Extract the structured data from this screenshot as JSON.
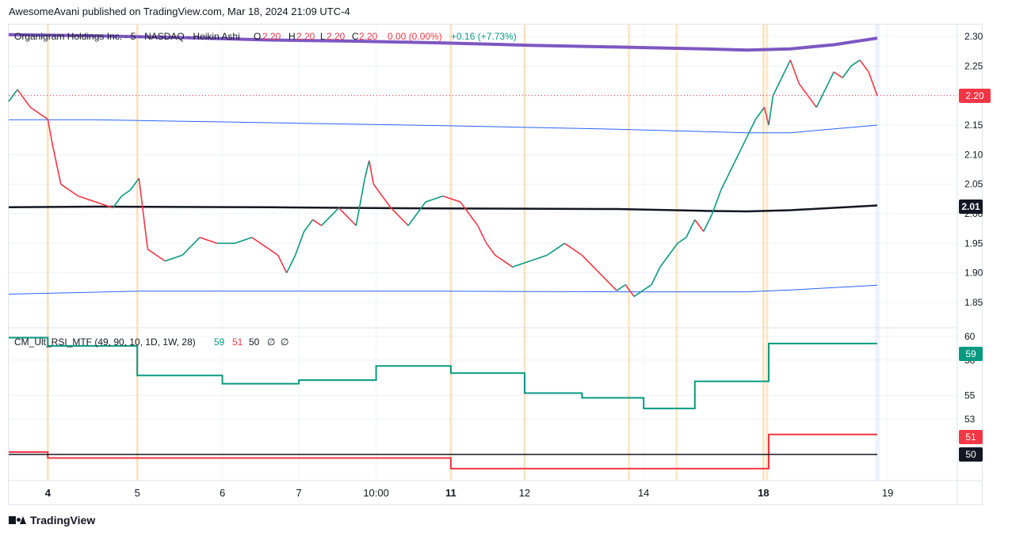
{
  "header": {
    "publish_line": "AwesomeAvani published on TradingView.com, Mar 18, 2024 21:09 UTC-4"
  },
  "footer": {
    "brand": "TradingView"
  },
  "colors": {
    "up": "#089981",
    "down": "#f23645",
    "ma_purple": "#7e57c2",
    "band_blue": "#2962ff",
    "mid_black": "#131722",
    "rsi_green": "#089981",
    "rsi_red": "#f23645",
    "grid": "#f0f3fa",
    "session_orange": "#ff9800",
    "axis_text": "#131722"
  },
  "main_pane": {
    "symbol": "Organigram Holdings Inc. · 5 · NASDAQ · Heikin Ashi",
    "ohlc": {
      "o_label": "O",
      "o": "2.20",
      "h_label": "H",
      "h": "2.20",
      "l_label": "L",
      "l": "2.20",
      "c_label": "C",
      "c": "2.20",
      "change": "0.00 (0.00%)",
      "extra": "+0.16 (+7.73%)"
    },
    "last_price_label": "2.20",
    "mid_line_label": "2.01"
  },
  "rsi_pane": {
    "title": "CM_Ult_RSI_MTF (49, 90, 10, 1D, 1W, 28)",
    "values": [
      "59",
      "51",
      "50",
      "∅",
      "∅"
    ],
    "labels": {
      "green": "59",
      "red": "51",
      "black": "50"
    }
  },
  "chart_data": [
    {
      "type": "line",
      "title": "Organigram Holdings Inc. · 5 · NASDAQ · Heikin Ashi",
      "y_ticks": [
        "2.30",
        "2.25",
        "2.20",
        "2.15",
        "2.10",
        "2.05",
        "2.00",
        "1.95",
        "1.90",
        "1.85"
      ],
      "ylim": [
        1.82,
        2.31
      ],
      "x_ticks": [
        {
          "label": "4",
          "bold": true,
          "t": 0.045
        },
        {
          "label": "5",
          "bold": false,
          "t": 0.148
        },
        {
          "label": "6",
          "bold": false,
          "t": 0.246
        },
        {
          "label": "7",
          "bold": false,
          "t": 0.334
        },
        {
          "label": "10:00",
          "bold": false,
          "t": 0.423
        },
        {
          "label": "11",
          "bold": true,
          "t": 0.509
        },
        {
          "label": "12",
          "bold": false,
          "t": 0.594
        },
        {
          "label": "14",
          "bold": false,
          "t": 0.731
        },
        {
          "label": "18",
          "bold": true,
          "t": 0.869
        },
        {
          "label": "19",
          "bold": false,
          "t": 1.012
        }
      ],
      "series": [
        {
          "role": "price",
          "color": "#089981",
          "x": [
            0,
            0.01,
            0.025,
            0.045,
            0.05,
            0.06,
            0.08,
            0.1,
            0.12,
            0.13,
            0.14,
            0.15,
            0.155,
            0.16,
            0.18,
            0.2,
            0.22,
            0.24,
            0.26,
            0.28,
            0.3,
            0.31,
            0.32,
            0.33,
            0.34,
            0.35,
            0.36,
            0.38,
            0.4,
            0.41,
            0.415,
            0.42,
            0.43,
            0.44,
            0.46,
            0.47,
            0.48,
            0.5,
            0.52,
            0.53,
            0.54,
            0.55,
            0.56,
            0.58,
            0.6,
            0.62,
            0.63,
            0.64,
            0.66,
            0.68,
            0.7,
            0.71,
            0.72,
            0.73,
            0.74,
            0.75,
            0.76,
            0.77,
            0.78,
            0.79,
            0.8,
            0.81,
            0.82,
            0.83,
            0.84,
            0.85,
            0.86,
            0.87,
            0.875,
            0.88,
            0.89,
            0.9,
            0.91,
            0.92,
            0.93,
            0.94,
            0.95,
            0.96,
            0.97,
            0.98,
            0.99,
            1.0
          ],
          "y": [
            2.19,
            2.21,
            2.18,
            2.16,
            2.12,
            2.05,
            2.03,
            2.02,
            2.01,
            2.03,
            2.04,
            2.06,
            2.0,
            1.94,
            1.92,
            1.93,
            1.96,
            1.95,
            1.95,
            1.96,
            1.94,
            1.93,
            1.9,
            1.93,
            1.97,
            1.99,
            1.98,
            2.01,
            1.98,
            2.06,
            2.09,
            2.05,
            2.03,
            2.01,
            1.98,
            2.0,
            2.02,
            2.03,
            2.02,
            2.0,
            1.98,
            1.95,
            1.93,
            1.91,
            1.92,
            1.93,
            1.94,
            1.95,
            1.93,
            1.9,
            1.87,
            1.88,
            1.86,
            1.87,
            1.88,
            1.91,
            1.93,
            1.95,
            1.96,
            1.99,
            1.97,
            2.0,
            2.04,
            2.07,
            2.1,
            2.13,
            2.16,
            2.18,
            2.15,
            2.2,
            2.23,
            2.26,
            2.22,
            2.2,
            2.18,
            2.21,
            2.24,
            2.23,
            2.25,
            2.26,
            2.24,
            2.2
          ]
        },
        {
          "role": "ma_long",
          "name": "",
          "color": "#7e57c2",
          "x": [
            0,
            0.1,
            0.2,
            0.3,
            0.4,
            0.5,
            0.6,
            0.7,
            0.8,
            0.85,
            0.9,
            0.95,
            1.0
          ],
          "y": [
            2.303,
            2.301,
            2.298,
            2.294,
            2.292,
            2.289,
            2.285,
            2.282,
            2.279,
            2.277,
            2.279,
            2.286,
            2.297
          ]
        },
        {
          "role": "band_upper",
          "color": "#2962ff",
          "x": [
            0,
            0.1,
            0.3,
            0.5,
            0.7,
            0.85,
            0.9,
            1.0
          ],
          "y": [
            2.159,
            2.159,
            2.154,
            2.149,
            2.143,
            2.137,
            2.137,
            2.15
          ]
        },
        {
          "role": "mid",
          "color": "#131722",
          "x": [
            0,
            0.1,
            0.3,
            0.5,
            0.7,
            0.8,
            0.85,
            0.9,
            1.0
          ],
          "y": [
            2.011,
            2.012,
            2.011,
            2.009,
            2.008,
            2.005,
            2.004,
            2.006,
            2.014
          ]
        },
        {
          "role": "band_lower",
          "color": "#2962ff",
          "x": [
            0,
            0.15,
            0.3,
            0.5,
            0.7,
            0.85,
            0.9,
            1.0
          ],
          "y": [
            1.864,
            1.869,
            1.869,
            1.869,
            1.868,
            1.868,
            1.871,
            1.879
          ]
        }
      ],
      "last_price": 2.2,
      "session_lines": [
        0.045,
        0.148,
        0.509,
        0.594,
        0.714,
        0.769,
        0.869,
        0.873
      ]
    },
    {
      "type": "line",
      "title": "CM_Ult_RSI_MTF (49, 90, 10, 1D, 1W, 28)",
      "y_ticks": [
        "60",
        "58",
        "55",
        "53"
      ],
      "ylim": [
        48,
        61
      ],
      "series": [
        {
          "name": "59",
          "color": "#089981",
          "steps": [
            [
              0,
              59.9
            ],
            [
              0.045,
              59.9
            ],
            [
              0.045,
              59.2
            ],
            [
              0.148,
              59.2
            ],
            [
              0.148,
              56.7
            ],
            [
              0.246,
              56.7
            ],
            [
              0.246,
              56.0
            ],
            [
              0.334,
              56.0
            ],
            [
              0.334,
              56.3
            ],
            [
              0.423,
              56.3
            ],
            [
              0.423,
              57.5
            ],
            [
              0.509,
              57.5
            ],
            [
              0.509,
              56.9
            ],
            [
              0.594,
              56.9
            ],
            [
              0.594,
              55.2
            ],
            [
              0.66,
              55.2
            ],
            [
              0.66,
              54.8
            ],
            [
              0.731,
              54.8
            ],
            [
              0.731,
              53.9
            ],
            [
              0.79,
              53.9
            ],
            [
              0.79,
              56.2
            ],
            [
              0.875,
              56.2
            ],
            [
              0.875,
              59.4
            ],
            [
              1.0,
              59.4
            ]
          ]
        },
        {
          "name": "51",
          "color": "#f23645",
          "steps": [
            [
              0,
              50.2
            ],
            [
              0.045,
              50.2
            ],
            [
              0.045,
              49.7
            ],
            [
              0.509,
              49.7
            ],
            [
              0.509,
              48.8
            ],
            [
              0.875,
              48.8
            ],
            [
              0.875,
              51.7
            ],
            [
              1.0,
              51.7
            ]
          ]
        },
        {
          "name": "50",
          "color": "#131722",
          "steps": [
            [
              0,
              50.0
            ],
            [
              1.0,
              50.0
            ]
          ]
        }
      ]
    }
  ]
}
